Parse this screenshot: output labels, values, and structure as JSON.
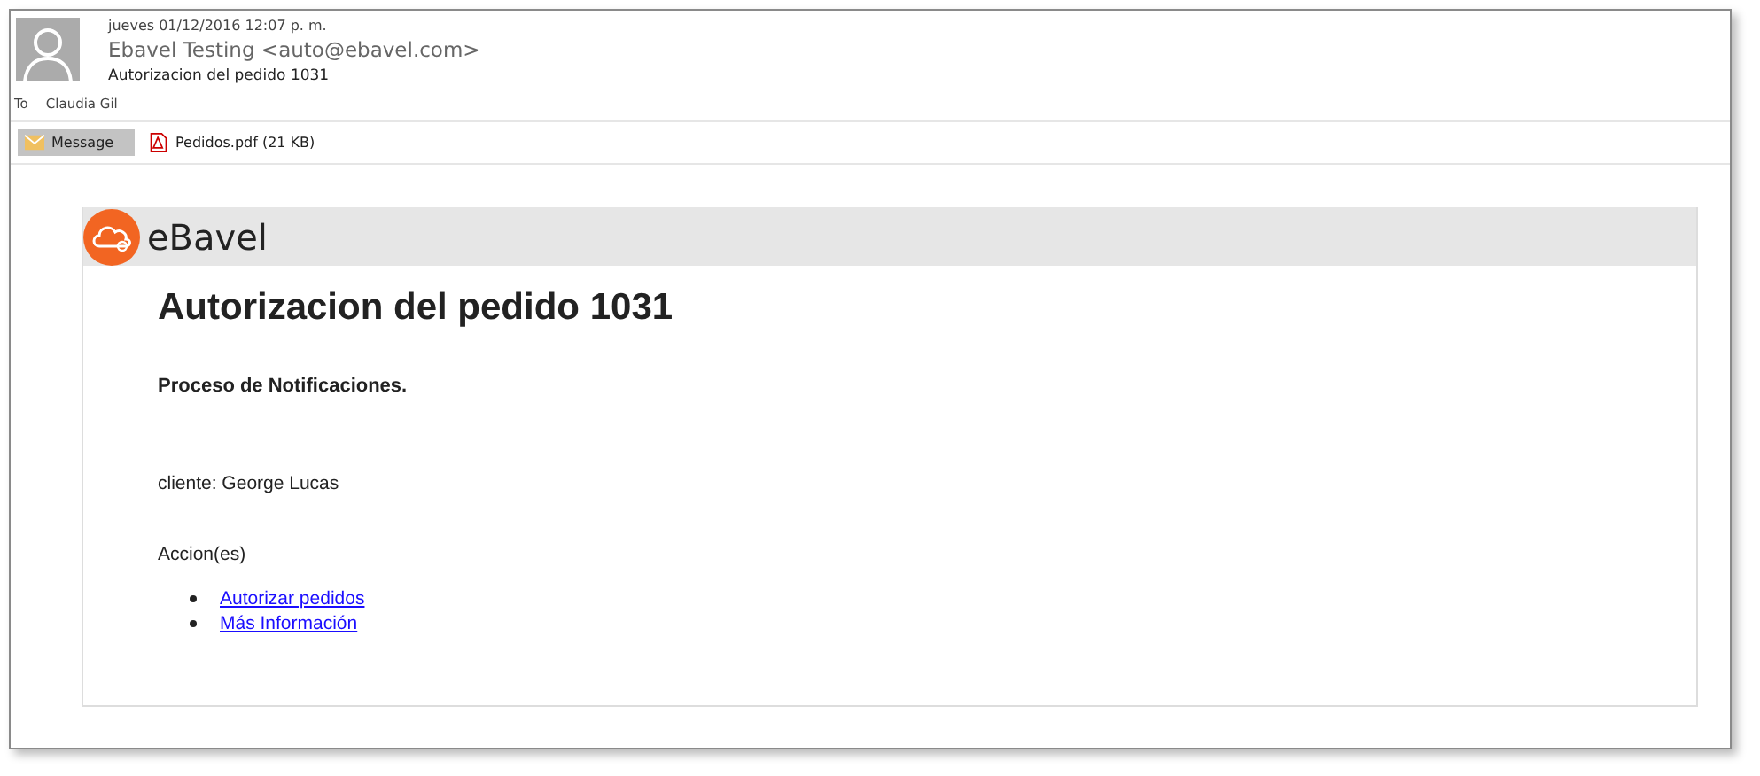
{
  "header": {
    "date": "jueves 01/12/2016 12:07 p. m.",
    "sender": "Ebavel Testing <auto@ebavel.com>",
    "subject": "Autorizacion del pedido 1031",
    "to_label": "To",
    "to": "Claudia Gil"
  },
  "attachments": [
    {
      "kind": "message",
      "label": "Message",
      "selected": true
    },
    {
      "kind": "pdf",
      "label": "Pedidos.pdf (21 KB)",
      "selected": false
    }
  ],
  "body": {
    "logo_text": "eBavel",
    "title": "Autorizacion del pedido 1031",
    "subtitle": "Proceso de Notificaciones.",
    "client": "cliente: George Lucas",
    "actions_label": "Accion(es)",
    "links": [
      "Autorizar pedidos",
      "Más Información"
    ]
  }
}
